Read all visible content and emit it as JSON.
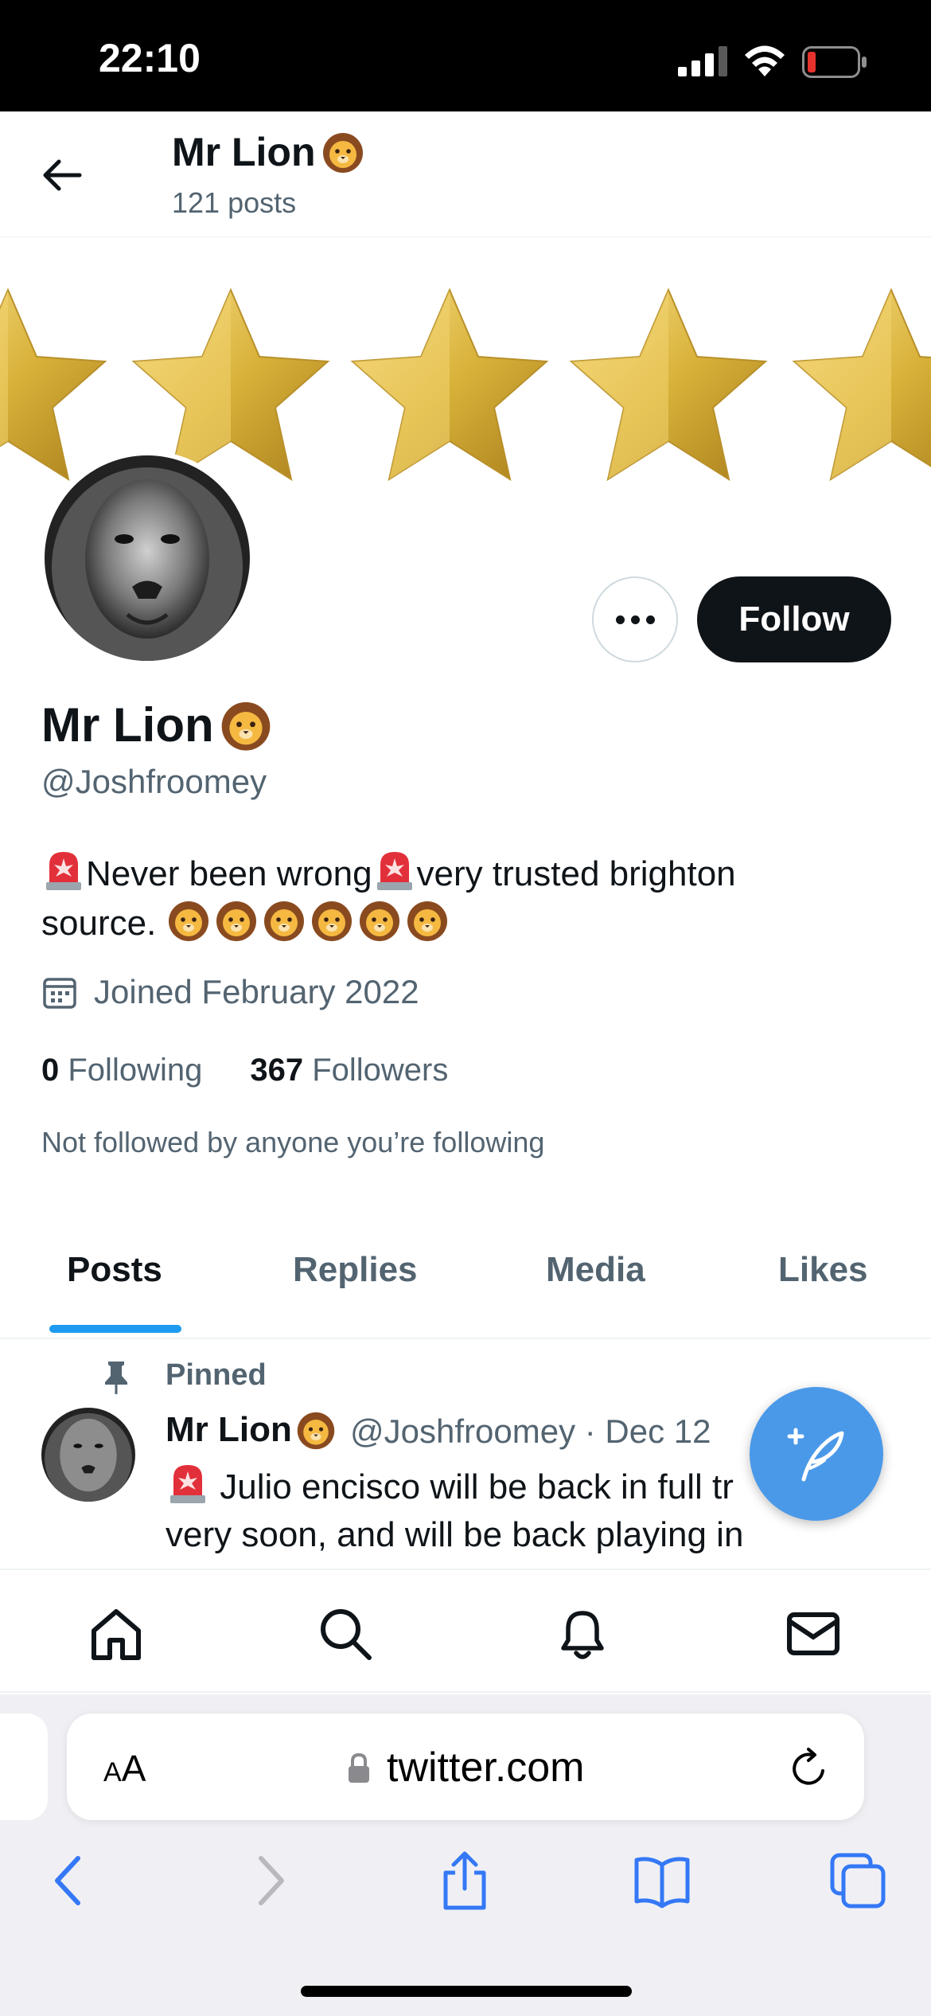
{
  "status_bar": {
    "time": "22:10",
    "icons": [
      "cellular-signal-icon",
      "wifi-icon",
      "battery-low-icon"
    ],
    "battery_color": "#e5322d"
  },
  "header": {
    "name": "Mr Lion",
    "name_emoji": "lion-face-icon",
    "post_count": "121 posts",
    "back_icon": "arrow-left-icon"
  },
  "banner": {
    "description_icons": [
      "gold-star-icon",
      "gold-star-icon",
      "gold-star-icon",
      "gold-star-icon",
      "gold-star-icon"
    ],
    "star_color": "#d9b23a"
  },
  "profile": {
    "name": "Mr Lion",
    "handle": "@Joshfroomey",
    "bio_part1": "Never been wrong",
    "bio_part2": "very trusted brighton",
    "bio_part3": "source.",
    "joined": "Joined February 2022",
    "following_count": "0",
    "following_label": "Following",
    "followers_count": "367",
    "followers_label": "Followers",
    "not_followed": "Not followed by anyone you’re following"
  },
  "actions": {
    "more_icon": "more-horizontal-icon",
    "follow_label": "Follow"
  },
  "tabs": [
    {
      "label": "Posts",
      "active": true
    },
    {
      "label": "Replies",
      "active": false
    },
    {
      "label": "Media",
      "active": false
    },
    {
      "label": "Likes",
      "active": false
    }
  ],
  "pinned_post": {
    "pinned_label": "Pinned",
    "author_name": "Mr Lion",
    "meta": "@Joshfroomey · Dec 12",
    "text_line1": "Julio encisco will be back in full tr",
    "text_line2": "very soon, and will be back playing in"
  },
  "bottom_nav": [
    "home-icon",
    "search-icon",
    "notifications-bell-icon",
    "messages-mail-icon"
  ],
  "safari": {
    "text_size_small": "A",
    "text_size_large": "A",
    "domain": "twitter.com",
    "toolbar_icons": [
      "back-chevron-icon",
      "forward-chevron-icon",
      "share-icon",
      "bookmarks-book-icon",
      "tabs-icon"
    ],
    "accent": "#3478f6"
  },
  "colors": {
    "text_primary": "#0f1419",
    "text_secondary": "#536471",
    "twitter_blue": "#1d9bf0",
    "fab_blue": "#4a99e9",
    "siren_red": "#e2303a"
  }
}
